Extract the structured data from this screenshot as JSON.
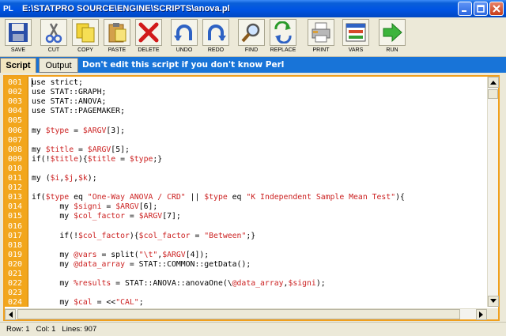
{
  "window": {
    "app_icon": "PL",
    "title": "E:\\STATPRO SOURCE\\ENGINE\\SCRIPTS\\anova.pl",
    "controls": [
      "minimize-icon",
      "maximize-icon",
      "close-icon"
    ]
  },
  "toolbar": [
    {
      "label": "SAVE",
      "icon": "floppy-icon"
    },
    {
      "label": "CUT",
      "icon": "scissors-icon"
    },
    {
      "label": "COPY",
      "icon": "copy-icon"
    },
    {
      "label": "PASTE",
      "icon": "paste-icon"
    },
    {
      "label": "DELETE",
      "icon": "delete-x-icon"
    },
    {
      "label": "UNDO",
      "icon": "undo-icon"
    },
    {
      "label": "REDO",
      "icon": "redo-icon"
    },
    {
      "label": "FIND",
      "icon": "magnifier-icon"
    },
    {
      "label": "REPLACE",
      "icon": "replace-arrows-icon"
    },
    {
      "label": "PRINT",
      "icon": "printer-icon"
    },
    {
      "label": "VARS",
      "icon": "variables-window-icon"
    },
    {
      "label": "RUN",
      "icon": "run-arrow-icon"
    }
  ],
  "tabs": [
    {
      "label": "Script",
      "active": true
    },
    {
      "label": "Output",
      "active": false
    }
  ],
  "notice": "Don't edit this script if you don't know Perl",
  "editor": {
    "line_numbers": [
      "001",
      "002",
      "003",
      "004",
      "005",
      "006",
      "007",
      "008",
      "009",
      "010",
      "011",
      "012",
      "013",
      "014",
      "015",
      "016",
      "017",
      "018",
      "019",
      "020",
      "021",
      "022",
      "023",
      "024"
    ],
    "lines": [
      [
        [
          "use strict;",
          "#000"
        ]
      ],
      [
        [
          "use STAT::GRAPH;",
          "#000"
        ]
      ],
      [
        [
          "use STAT::ANOVA;",
          "#000"
        ]
      ],
      [
        [
          "use STAT::PAGEMAKER;",
          "#000"
        ]
      ],
      [],
      [
        [
          "my ",
          "#000"
        ],
        [
          "$type",
          "#cc2222"
        ],
        [
          " = ",
          "#000"
        ],
        [
          "$ARGV",
          "#cc2222"
        ],
        [
          "[3];",
          "#000"
        ]
      ],
      [],
      [
        [
          "my ",
          "#000"
        ],
        [
          "$title",
          "#cc2222"
        ],
        [
          " = ",
          "#000"
        ],
        [
          "$ARGV",
          "#cc2222"
        ],
        [
          "[5];",
          "#000"
        ]
      ],
      [
        [
          "if(!",
          "#000"
        ],
        [
          "$title",
          "#cc2222"
        ],
        [
          "){",
          "#000"
        ],
        [
          "$title",
          "#cc2222"
        ],
        [
          " = ",
          "#000"
        ],
        [
          "$type",
          "#cc2222"
        ],
        [
          ";}",
          "#000"
        ]
      ],
      [],
      [
        [
          "my (",
          "#000"
        ],
        [
          "$i",
          "#cc2222"
        ],
        [
          ",",
          "#000"
        ],
        [
          "$j",
          "#cc2222"
        ],
        [
          ",",
          "#000"
        ],
        [
          "$k",
          "#cc2222"
        ],
        [
          ");",
          "#000"
        ]
      ],
      [],
      [
        [
          "if(",
          "#000"
        ],
        [
          "$type",
          "#cc2222"
        ],
        [
          " eq ",
          "#000"
        ],
        [
          "\"One-Way ANOVA / CRD\"",
          "#cc2222"
        ],
        [
          " || ",
          "#000"
        ],
        [
          "$type",
          "#cc2222"
        ],
        [
          " eq ",
          "#000"
        ],
        [
          "\"K Independent Sample Mean Test\"",
          "#cc2222"
        ],
        [
          "){",
          "#000"
        ]
      ],
      [
        [
          "      my ",
          "#000"
        ],
        [
          "$signi",
          "#cc2222"
        ],
        [
          " = ",
          "#000"
        ],
        [
          "$ARGV",
          "#cc2222"
        ],
        [
          "[6];",
          "#000"
        ]
      ],
      [
        [
          "      my ",
          "#000"
        ],
        [
          "$col_factor",
          "#cc2222"
        ],
        [
          " = ",
          "#000"
        ],
        [
          "$ARGV",
          "#cc2222"
        ],
        [
          "[7];",
          "#000"
        ]
      ],
      [],
      [
        [
          "      if(!",
          "#000"
        ],
        [
          "$col_factor",
          "#cc2222"
        ],
        [
          "){",
          "#000"
        ],
        [
          "$col_factor",
          "#cc2222"
        ],
        [
          " = ",
          "#000"
        ],
        [
          "\"Between\"",
          "#cc2222"
        ],
        [
          ";}",
          "#000"
        ]
      ],
      [],
      [
        [
          "      my ",
          "#000"
        ],
        [
          "@vars",
          "#cc2222"
        ],
        [
          " = split(",
          "#000"
        ],
        [
          "\"\\t\"",
          "#cc2222"
        ],
        [
          ",",
          "#000"
        ],
        [
          "$ARGV",
          "#cc2222"
        ],
        [
          "[4]);",
          "#000"
        ]
      ],
      [
        [
          "      my ",
          "#000"
        ],
        [
          "@data_array",
          "#cc2222"
        ],
        [
          " = STAT::COMMON::getData();",
          "#000"
        ]
      ],
      [],
      [
        [
          "      my ",
          "#000"
        ],
        [
          "%results",
          "#cc2222"
        ],
        [
          " = STAT::ANOVA::anovaOne(\\",
          "#000"
        ],
        [
          "@data_array",
          "#cc2222"
        ],
        [
          ",",
          "#000"
        ],
        [
          "$signi",
          "#cc2222"
        ],
        [
          ");",
          "#000"
        ]
      ],
      [],
      [
        [
          "      my ",
          "#000"
        ],
        [
          "$cal",
          "#cc2222"
        ],
        [
          " = <<",
          "#000"
        ],
        [
          "\"CAL\"",
          "#cc2222"
        ],
        [
          ";",
          "#000"
        ]
      ]
    ]
  },
  "status": {
    "row": "Row: 1",
    "col": "Col: 1",
    "lines": "Lines: 907"
  }
}
